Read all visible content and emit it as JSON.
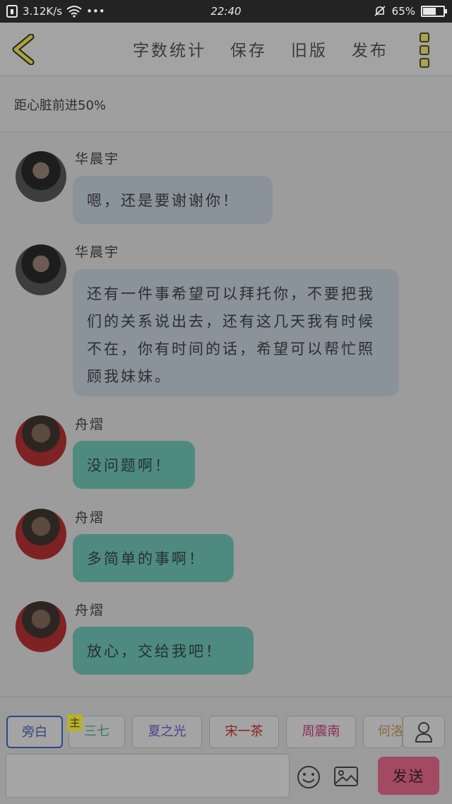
{
  "status_bar": {
    "net_speed": "3.12K/s",
    "more": "•••",
    "time": "22:40",
    "battery_pct": "65%",
    "battery_level": 0.65
  },
  "toolbar": {
    "word_count": "字数统计",
    "save": "保存",
    "old_version": "旧版",
    "publish": "发布"
  },
  "subtitle": "距心脏前进50%",
  "messages": [
    {
      "speaker": "华晨宇",
      "text": "嗯，还是要谢谢你！"
    },
    {
      "speaker": "华晨宇",
      "text": "还有一件事希望可以拜托你，不要把我们的关系说出去，还有这几天我有时候不在，你有时间的话，希望可以帮忙照顾我妹妹。"
    },
    {
      "speaker": "舟熠",
      "text": "没问题啊！"
    },
    {
      "speaker": "舟熠",
      "text": "多简单的事啊！"
    },
    {
      "speaker": "舟熠",
      "text": "放心，交给我吧！"
    }
  ],
  "characters": [
    {
      "label": "旁白",
      "color": "#36447a"
    },
    {
      "label": "三七",
      "color": "#2e7a6e"
    },
    {
      "label": "夏之光",
      "color": "#4a3f86"
    },
    {
      "label": "宋一茶",
      "color": "#8a2020"
    },
    {
      "label": "周震南",
      "color": "#8a2a52"
    },
    {
      "label": "何洛",
      "color": "#8a6a40"
    }
  ],
  "main_badge": "主",
  "input": {
    "value": "",
    "placeholder": ""
  },
  "send": "发送"
}
